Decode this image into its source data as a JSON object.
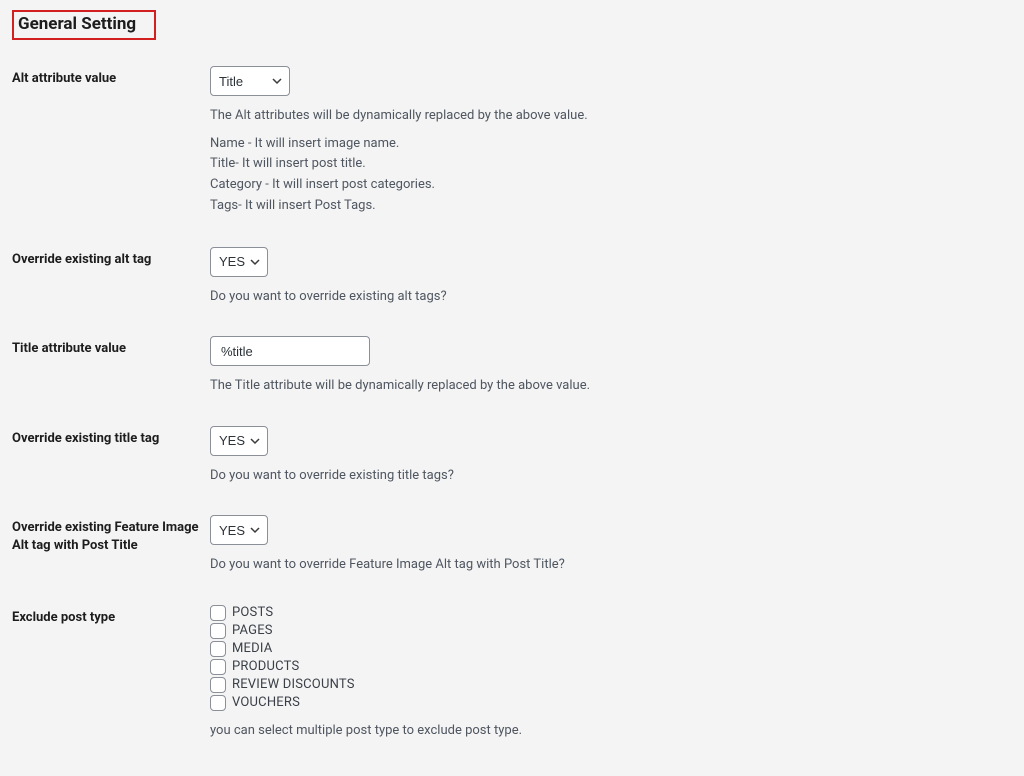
{
  "section_title": "General Setting",
  "fields": {
    "alt_attr": {
      "label": "Alt attribute value",
      "selected": "Title",
      "desc1": "The Alt attributes will be dynamically replaced by the above value.",
      "explain": {
        "name": "Name - It will insert image name.",
        "title": "Title- It will insert post title.",
        "category": "Category - It will insert post categories.",
        "tags": "Tags- It will insert Post Tags."
      }
    },
    "override_alt": {
      "label": "Override existing alt tag",
      "selected": "YES",
      "desc": "Do you want to override existing alt tags?"
    },
    "title_attr": {
      "label": "Title attribute value",
      "value": "%title",
      "desc": "The Title attribute will be dynamically replaced by the above value."
    },
    "override_title": {
      "label": "Override existing title tag",
      "selected": "YES",
      "desc": "Do you want to override existing title tags?"
    },
    "override_feature": {
      "label": "Override existing Feature Image Alt tag with Post Title",
      "selected": "YES",
      "desc": "Do you want to override Feature Image Alt tag with Post Title?"
    },
    "exclude": {
      "label": "Exclude post type",
      "options": {
        "posts": "POSTS",
        "pages": "PAGES",
        "media": "MEDIA",
        "products": "PRODUCTS",
        "review_discounts": "REVIEW DISCOUNTS",
        "vouchers": "VOUCHERS"
      },
      "desc": "you can select multiple post type to exclude post type."
    }
  }
}
